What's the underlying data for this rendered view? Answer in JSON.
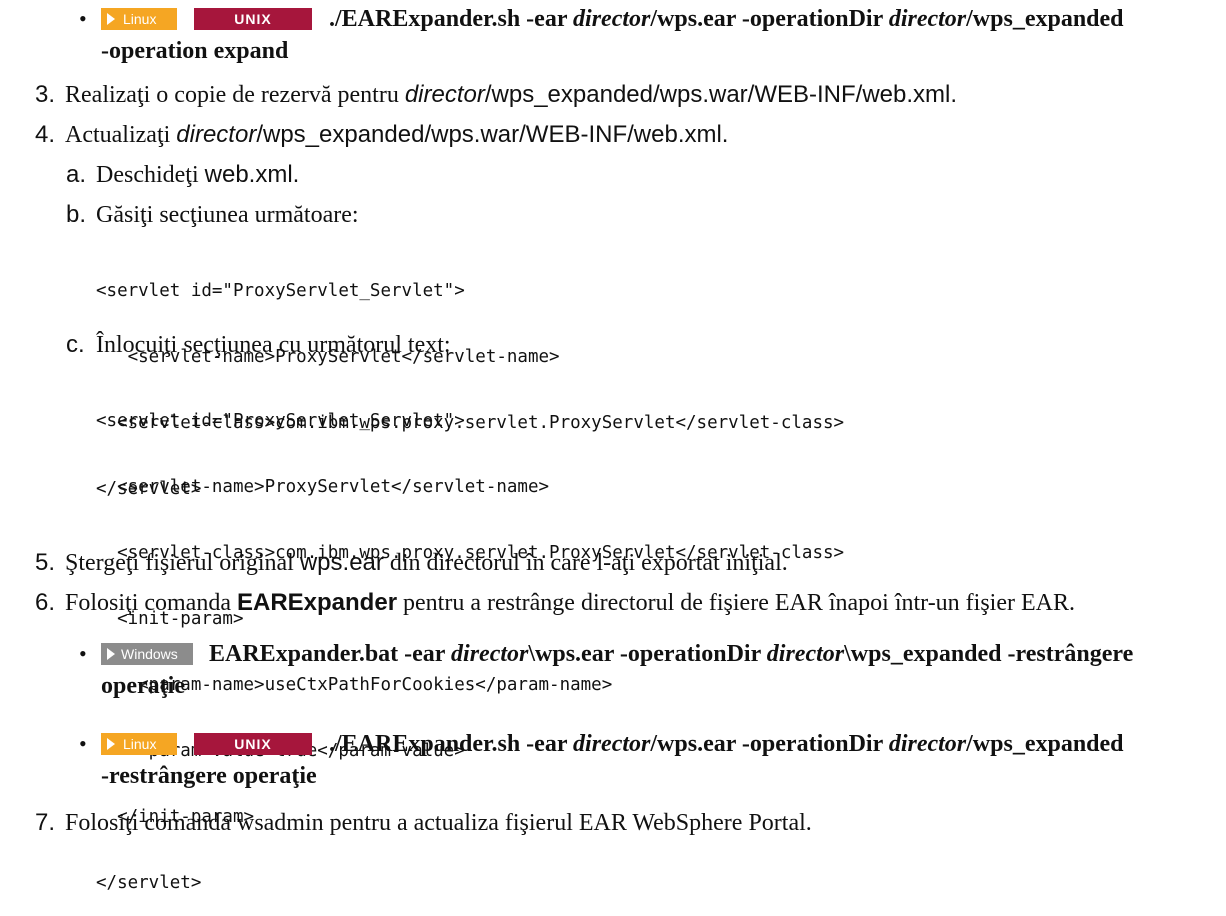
{
  "bullet_char": "•",
  "tags": {
    "linux": "Linux",
    "unix": "UNIX",
    "windows": "Windows"
  },
  "item0": {
    "cmd1": "./EARExpander.sh -ear ",
    "dir1": "director",
    "cmd2": "/wps.ear -operationDir ",
    "dir2": "director",
    "cmd3": "/wps_expanded",
    "cont": "-operation expand"
  },
  "step3": {
    "num": "3.",
    "text1": "Realizaţi o copie de rezervă pentru ",
    "dir": "director",
    "path": "/wps_expanded/wps.war/WEB-INF/web.xml."
  },
  "step4": {
    "num": "4.",
    "text1": "Actualizaţi ",
    "dir": "director",
    "path": "/wps_expanded/wps.war/WEB-INF/web.xml."
  },
  "step4a": {
    "letter": "a.",
    "text1": "Deschideţi ",
    "file": "web.xml."
  },
  "step4b": {
    "letter": "b.",
    "text": "Găsiţi secţiunea următoare:"
  },
  "code1": [
    "<servlet id=\"ProxyServlet_Servlet\">",
    "   <servlet-name>ProxyServlet</servlet-name>",
    "  <servlet-class>com.ibm.wps.proxy.servlet.ProxyServlet</servlet-class>",
    "</servlet>"
  ],
  "step4c": {
    "letter": "c.",
    "text": "Înlocuiţi secţiunea cu următorul text:"
  },
  "code2": [
    "<servlet id=\"ProxyServlet_Servlet\">",
    "  <servlet-name>ProxyServlet</servlet-name>",
    "  <servlet-class>com.ibm.wps.proxy.servlet.ProxyServlet</servlet-class>",
    "  <init-param>",
    "    <param-name>useCtxPathForCookies</param-name>",
    "    <param-value>true</param-value>",
    "  </init-param>",
    "</servlet>"
  ],
  "step5": {
    "num": "5.",
    "text1": "Ştergeţi fişierul original ",
    "file": "wps.ear",
    "text2": " din directorul în care l-aţi exportat iniţial."
  },
  "step6": {
    "num": "6.",
    "text1": "Folosiţi comanda ",
    "cmd": "EARExpander",
    "text2": " pentru a restrânge directorul de fişiere EAR înapoi într-un fişier EAR."
  },
  "item6a": {
    "cmd1": "EARExpander.bat -ear ",
    "dir1": "director",
    "cmd2": "\\wps.ear -operationDir ",
    "dir2": "director",
    "cmd3": "\\wps_expanded -restrângere",
    "cont": "operaţie"
  },
  "item6b": {
    "cmd1": "./EARExpander.sh -ear ",
    "dir1": "director",
    "cmd2": "/wps.ear -operationDir ",
    "dir2": "director",
    "cmd3": "/wps_expanded",
    "cont": "-restrângere operaţie"
  },
  "step7": {
    "num": "7.",
    "text": "Folosiţi comanda wsadmin pentru a actualiza fişierul EAR WebSphere Portal."
  }
}
